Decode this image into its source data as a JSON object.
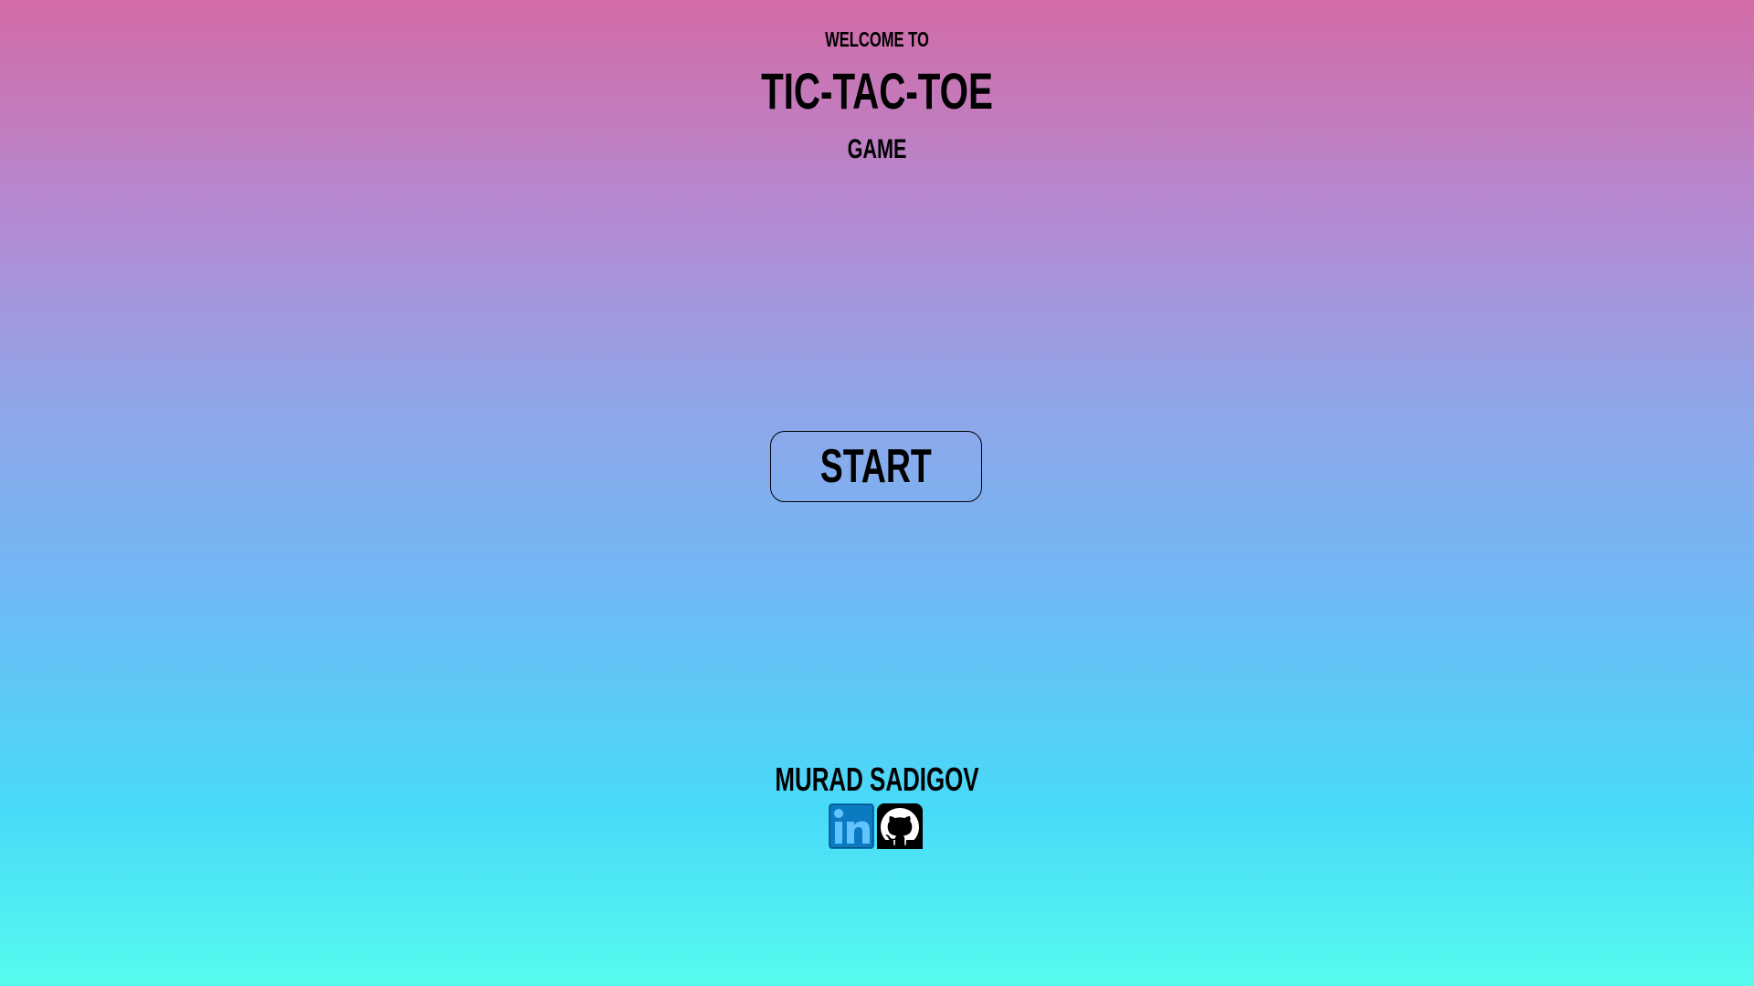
{
  "header": {
    "welcome": "WELCOME TO",
    "title": "TIC-TAC-TOE",
    "subtitle": "GAME"
  },
  "start_button": {
    "label": "START"
  },
  "footer": {
    "author": "MURAD SADIGOV",
    "socials": [
      {
        "icon": "linkedin-icon",
        "color": "#0a7bc1"
      },
      {
        "icon": "github-icon",
        "color": "#000000"
      }
    ]
  },
  "colors": {
    "gradient_top": "#d26ba6",
    "gradient_mid": "#8ea7ea",
    "gradient_bottom": "#57fbee",
    "text": "#000000"
  }
}
